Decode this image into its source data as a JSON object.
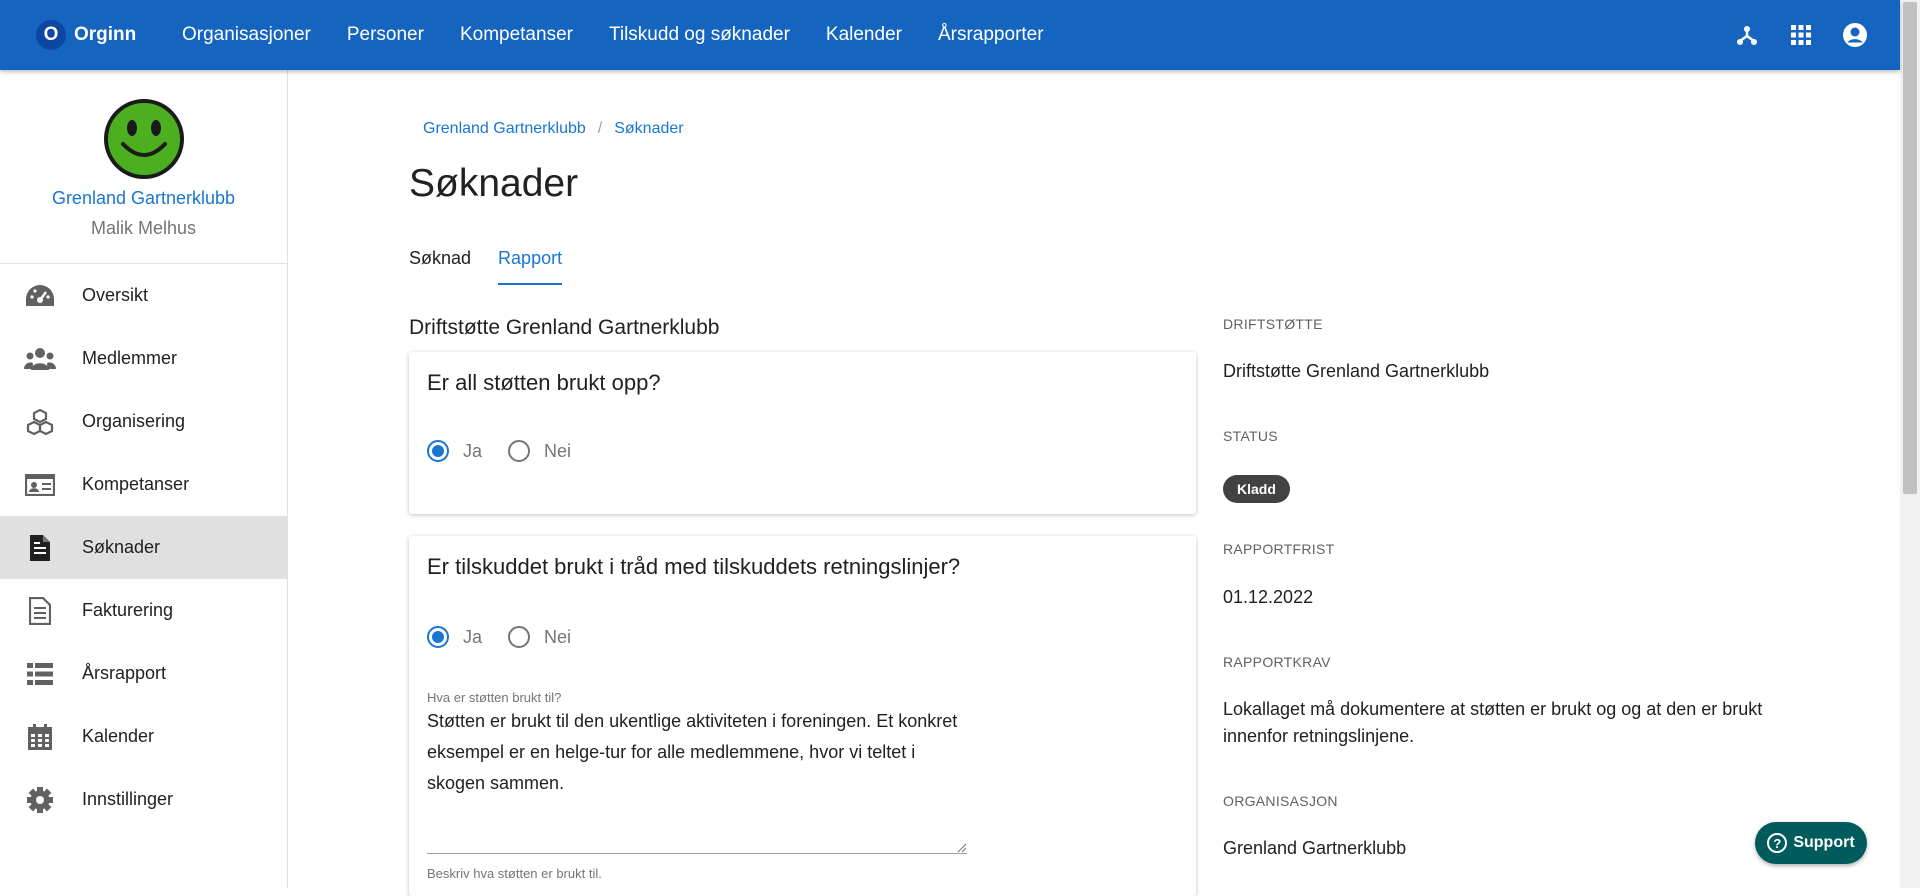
{
  "topbar": {
    "logo_letter": "O",
    "brand": "Orginn",
    "nav": [
      "Organisasjoner",
      "Personer",
      "Kompetanser",
      "Tilskudd og søknader",
      "Kalender",
      "Årsrapporter"
    ]
  },
  "sidebar": {
    "org_name": "Grenland Gartnerklubb",
    "user_name": "Malik Melhus",
    "items": [
      {
        "label": "Oversikt",
        "icon": "dashboard-icon"
      },
      {
        "label": "Medlemmer",
        "icon": "people-icon"
      },
      {
        "label": "Organisering",
        "icon": "cubes-icon"
      },
      {
        "label": "Kompetanser",
        "icon": "id-card-icon"
      },
      {
        "label": "Søknader",
        "icon": "document-icon",
        "active": true
      },
      {
        "label": "Fakturering",
        "icon": "invoice-icon"
      },
      {
        "label": "Årsrapport",
        "icon": "list-icon"
      },
      {
        "label": "Kalender",
        "icon": "calendar-icon"
      },
      {
        "label": "Innstillinger",
        "icon": "gear-icon"
      }
    ]
  },
  "main": {
    "breadcrumb": [
      "Grenland Gartnerklubb",
      "Søknader"
    ],
    "title": "Søknader",
    "tabs": [
      "Søknad",
      "Rapport"
    ],
    "active_tab": "Rapport",
    "section_title": "Driftstøtte Grenland Gartnerklubb",
    "questions": [
      {
        "text": "Er all støtten brukt opp?",
        "options": [
          "Ja",
          "Nei"
        ],
        "selected": "Ja"
      },
      {
        "text": "Er tilskuddet brukt i tråd med tilskuddets retningslinjer?",
        "options": [
          "Ja",
          "Nei"
        ],
        "selected": "Ja"
      }
    ],
    "field": {
      "label": "Hva er støtten brukt til?",
      "value": "Støtten er brukt til den ukentlige aktiviteten i foreningen. Et konkret eksempel er en helge-tur for alle medlemmene, hvor vi teltet i skogen sammen.",
      "hint": "Beskriv hva støtten er brukt til."
    }
  },
  "info": {
    "driftstotte_label": "DRIFTSTØTTE",
    "driftstotte_value": "Driftstøtte Grenland Gartnerklubb",
    "status_label": "STATUS",
    "status_value": "Kladd",
    "rapportfrist_label": "RAPPORTFRIST",
    "rapportfrist_value": "01.12.2022",
    "rapportkrav_label": "RAPPORTKRAV",
    "rapportkrav_value": "Lokallaget må dokumentere at støtten er brukt og og at den er brukt innenfor retningslinjene.",
    "organisasjon_label": "ORGANISASJON",
    "organisasjon_value": "Grenland Gartnerklubb"
  },
  "support": {
    "label": "Support"
  },
  "colors": {
    "primary": "#1565c0",
    "link": "#1976d2",
    "badge": "#424242",
    "support": "#005c5c",
    "avatar": "#4caf1f"
  }
}
